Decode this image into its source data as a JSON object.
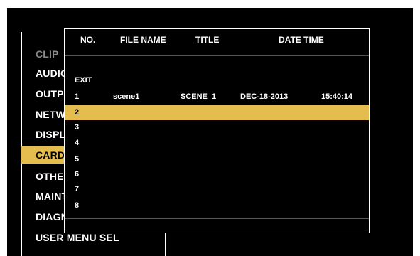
{
  "menu": {
    "items": [
      {
        "label": "CLIP",
        "state": "dim"
      },
      {
        "label": "AUDIO",
        "state": "normal"
      },
      {
        "label": "OUTPUT",
        "state": "normal"
      },
      {
        "label": "NETWORK",
        "state": "normal"
      },
      {
        "label": "DISPLAY",
        "state": "normal"
      },
      {
        "label": "CARD",
        "state": "selected"
      },
      {
        "label": "OTHERS",
        "state": "normal"
      },
      {
        "label": "MAINTENANCE",
        "state": "normal"
      },
      {
        "label": "DIAGNOSTIC",
        "state": "normal"
      },
      {
        "label": "USER MENU SEL",
        "state": "normal"
      }
    ]
  },
  "dialog": {
    "headers": {
      "no": "NO.",
      "file_name": "FILE NAME",
      "title": "TITLE",
      "date_time": "DATE TIME"
    },
    "exit_label": "EXIT",
    "rows": [
      {
        "no": "1",
        "file_name": "scene1",
        "title": "SCENE_1",
        "date": "DEC-18-2013",
        "time": "15:40:14"
      },
      {
        "no": "2",
        "file_name": "",
        "title": "",
        "date": "",
        "time": ""
      },
      {
        "no": "3",
        "file_name": "",
        "title": "",
        "date": "",
        "time": ""
      },
      {
        "no": "4",
        "file_name": "",
        "title": "",
        "date": "",
        "time": ""
      },
      {
        "no": "5",
        "file_name": "",
        "title": "",
        "date": "",
        "time": ""
      },
      {
        "no": "6",
        "file_name": "",
        "title": "",
        "date": "",
        "time": ""
      },
      {
        "no": "7",
        "file_name": "",
        "title": "",
        "date": "",
        "time": ""
      },
      {
        "no": "8",
        "file_name": "",
        "title": "",
        "date": "",
        "time": ""
      }
    ],
    "selected_row": "2"
  },
  "colors": {
    "highlight": "#e5bd4f",
    "background": "#000000",
    "text": "#ffffff"
  }
}
